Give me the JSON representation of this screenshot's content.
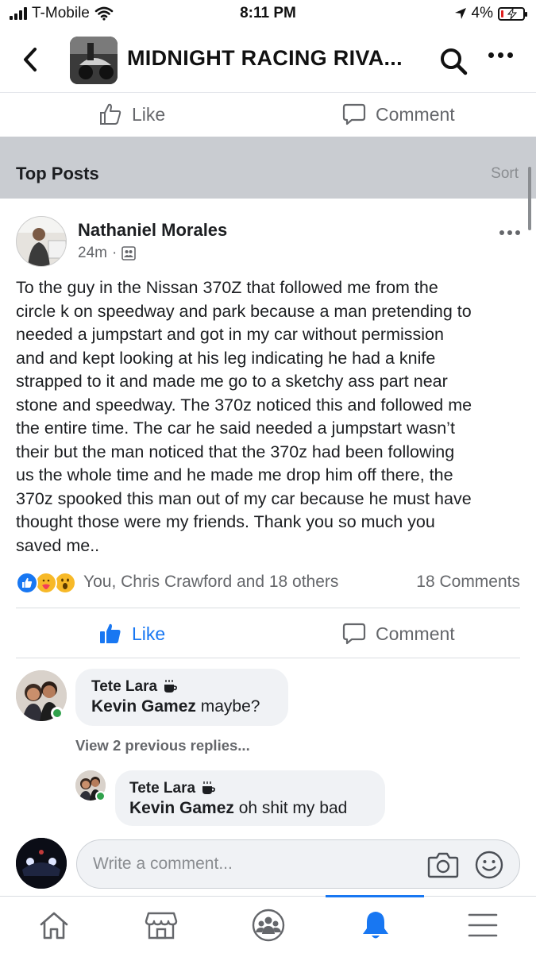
{
  "status_bar": {
    "carrier": "T-Mobile",
    "time": "8:11 PM",
    "battery": "4%"
  },
  "nav": {
    "title": "MIDNIGHT RACING RIVA..."
  },
  "top_actions": {
    "like": "Like",
    "comment": "Comment"
  },
  "section": {
    "title": "Top Posts",
    "sort": "Sort"
  },
  "post": {
    "author": "Nathaniel Morales",
    "time": "24m",
    "separator": "·",
    "body_lines": [
      "To the guy in the Nissan 370Z that followed me from the",
      "circle k on speedway and park because a man pretending to",
      "needed a jumpstart and got in my car without permission",
      "and and kept looking at his leg indicating  he had a knife",
      "strapped to it and made me go to a sketchy ass part near",
      "stone and speedway. The 370z noticed this and followed me",
      "the entire time. The car he said needed a jumpstart wasn’t",
      "their but the man noticed that the 370z had been following",
      "us the whole time and he made me drop him off there, the",
      "370z spooked this man out of my car because he must have",
      "thought those were my friends. Thank you so much you",
      "saved me.."
    ],
    "reactions_text": "You, Chris Crawford and 18 others",
    "comments_count": "18 Comments",
    "like": "Like",
    "comment": "Comment"
  },
  "comments": [
    {
      "name": "Tete Lara",
      "mention": "Kevin Gamez",
      "text": " maybe?"
    }
  ],
  "view_replies": "View 2 previous replies...",
  "replies": [
    {
      "name": "Tete Lara",
      "mention": "Kevin Gamez",
      "text": " oh shit my bad"
    }
  ],
  "composer": {
    "placeholder": "Write a comment..."
  },
  "colors": {
    "accent": "#1877f2",
    "section_bg": "#c9ccd1",
    "bubble_bg": "#f0f2f5",
    "online": "#31a24c"
  },
  "icons": {
    "tabs": [
      "home-icon",
      "marketplace-icon",
      "groups-icon",
      "notifications-icon",
      "menu-icon"
    ],
    "reactions": [
      "like-reaction-icon",
      "care-reaction-icon",
      "wow-reaction-icon"
    ]
  }
}
